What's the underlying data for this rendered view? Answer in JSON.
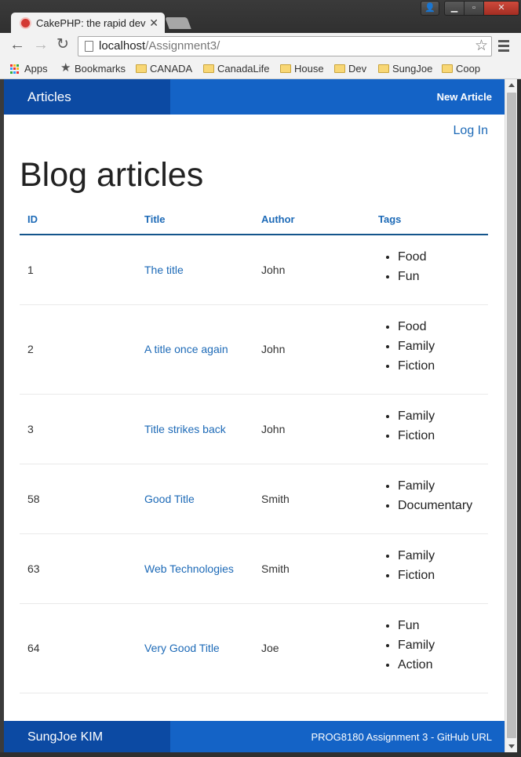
{
  "browser": {
    "tab_title": "CakePHP: the rapid deve",
    "url_host": "localhost",
    "url_path": "/Assignment3/",
    "bookmarks": [
      "Apps",
      "Bookmarks",
      "CANADA",
      "CanadaLife",
      "House",
      "Dev",
      "SungJoe",
      "Coop"
    ]
  },
  "navbar": {
    "brand": "Articles",
    "new_article": "New Article"
  },
  "login": "Log In",
  "page_title": "Blog articles",
  "table": {
    "headers": [
      "ID",
      "Title",
      "Author",
      "Tags"
    ],
    "rows": [
      {
        "id": "1",
        "title": "The title",
        "author": "John",
        "tags": [
          "Food",
          "Fun"
        ]
      },
      {
        "id": "2",
        "title": "A title once again",
        "author": "John",
        "tags": [
          "Food",
          "Family",
          "Fiction"
        ]
      },
      {
        "id": "3",
        "title": "Title strikes back",
        "author": "John",
        "tags": [
          "Family",
          "Fiction"
        ]
      },
      {
        "id": "58",
        "title": "Good Title",
        "author": "Smith",
        "tags": [
          "Family",
          "Documentary"
        ]
      },
      {
        "id": "63",
        "title": "Web Technologies",
        "author": "Smith",
        "tags": [
          "Family",
          "Fiction"
        ]
      },
      {
        "id": "64",
        "title": "Very Good Title",
        "author": "Joe",
        "tags": [
          "Fun",
          "Family",
          "Action"
        ]
      }
    ]
  },
  "footer": {
    "author": "SungJoe KIM",
    "link": "PROG8180 Assignment 3 - GitHub URL"
  },
  "colors": {
    "navbar": "#1463c6",
    "navbar_brand": "#0c4aa3",
    "link": "#1d6ab7"
  }
}
